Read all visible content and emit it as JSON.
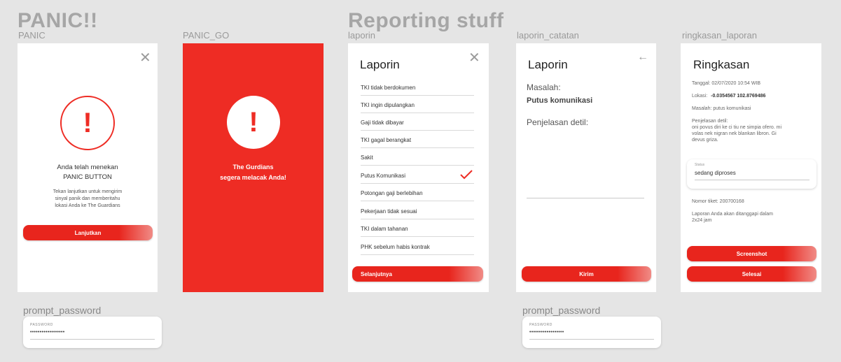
{
  "titles": {
    "panic": "PANIC!!",
    "reporting": "Reporting stuff"
  },
  "labels": {
    "panic": "PANIC",
    "panic_go": "PANIC_GO",
    "laporin": "laporin",
    "laporin_catatan": "laporin_catatan",
    "ringkasan_laporan": "ringkasan_laporan",
    "prompt_password_1": "prompt_password",
    "prompt_password_2": "prompt_password"
  },
  "panic": {
    "close_icon": "✕",
    "alert_icon": "!",
    "line1": "Anda telah menekan",
    "line2": "PANIC BUTTON",
    "desc1": "Tekan lanjutkan untuk mengirim",
    "desc2": "sinyal panik dan memberitahu",
    "desc3": "lokasi Anda ke The Guardians",
    "button": "Lanjutkan"
  },
  "panic_go": {
    "alert_icon": "!",
    "line1": "The Gurdians",
    "line2": "segera melacak Anda!"
  },
  "laporin": {
    "title": "Laporin",
    "close_icon": "✕",
    "items": [
      "TKI tidak berdokumen",
      "TKI ingin dipulangkan",
      "Gaji tidak dibayar",
      "TKI gagal berangkat",
      "Sakit",
      "Putus Komunikasi",
      "Potongan gaji berlebihan",
      "Pekerjaan tidak sesuai",
      "TKI dalam tahanan",
      "PHK sebelum habis kontrak"
    ],
    "selected": "Putus Komunikasi",
    "button": "Selanjutnya"
  },
  "laporin_catatan": {
    "title": "Laporin",
    "back_icon": "←",
    "masalah_label": "Masalah:",
    "masalah_value": "Putus komunikasi",
    "penjelasan_label": "Penjelasan detil:",
    "button": "Kirim"
  },
  "ringkasan": {
    "title": "Ringkasan",
    "tanggal": "Tanggal: 02/07/2020 10:54 WIB",
    "lokasi_label": "Lokasi:",
    "lokasi_value": "-0.0354567 102.8769486",
    "masalah": "Masalah: putus komunikasi",
    "penjelasan_label": "Penjelasan detil:",
    "penjelasan_l1": "oni povus diri ke ci tiu ne simpia ofero. mi",
    "penjelasan_l2": "volas nek nigran nek blankan libron. Gi",
    "penjelasan_l3": "devus griza.",
    "status_label": "Status",
    "status_value": "sedang diproses",
    "tiket": "Nomor tiket: 200700168",
    "info_l1": "Laporan Anda akan ditanggapi dalam",
    "info_l2": "2x24 jam",
    "button_screenshot": "Screenshot",
    "button_selesai": "Selesai"
  },
  "password": {
    "label": "PASSWORD",
    "value": "••••••••••••••••••",
    "label2": "PASSWORD",
    "value2": "••••••••••••••••••"
  },
  "colors": {
    "accent": "#ee2c24",
    "background": "#e5e5e5"
  }
}
